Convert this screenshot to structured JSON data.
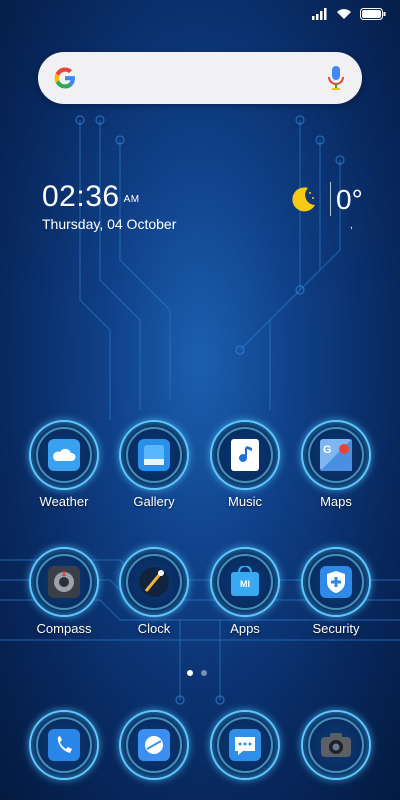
{
  "clock": {
    "time": "02:36",
    "ampm": "AM",
    "date": "Thursday, 04 October"
  },
  "weather": {
    "temperature": "0°",
    "sub": ","
  },
  "search": {
    "logo_icon": "google-g-icon",
    "mic_icon": "mic-icon"
  },
  "status": {
    "signal_icon": "signal-icon",
    "wifi_icon": "wifi-icon",
    "battery_icon": "battery-icon"
  },
  "apps_row1": [
    {
      "label": "Weather",
      "icon": "weather-cloud-icon"
    },
    {
      "label": "Gallery",
      "icon": "gallery-icon"
    },
    {
      "label": "Music",
      "icon": "music-note-icon"
    },
    {
      "label": "Maps",
      "icon": "maps-icon"
    }
  ],
  "apps_row2": [
    {
      "label": "Compass",
      "icon": "compass-icon"
    },
    {
      "label": "Clock",
      "icon": "clock-icon"
    },
    {
      "label": "Apps",
      "icon": "mi-apps-icon"
    },
    {
      "label": "Security",
      "icon": "shield-plus-icon"
    }
  ],
  "dock": [
    {
      "icon": "phone-icon"
    },
    {
      "icon": "browser-icon"
    },
    {
      "icon": "message-icon"
    },
    {
      "icon": "camera-icon"
    }
  ],
  "pages": {
    "count": 2,
    "active": 1
  }
}
